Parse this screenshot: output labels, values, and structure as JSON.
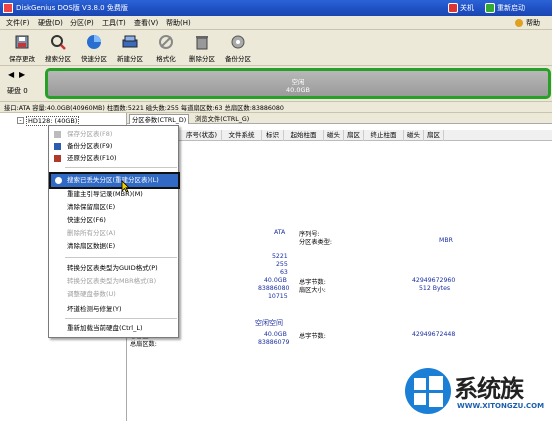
{
  "app": {
    "title": "DiskGenius DOS版 V3.8.0 免费版",
    "shutdown": "关机",
    "restart": "重新启动",
    "help": "帮助"
  },
  "menu": [
    "文件(F)",
    "硬盘(D)",
    "分区(P)",
    "工具(T)",
    "查看(V)",
    "帮助(H)"
  ],
  "toolbar": [
    {
      "label": "保存更改",
      "icon": "save-icon"
    },
    {
      "label": "搜索分区",
      "icon": "search-icon"
    },
    {
      "label": "快速分区",
      "icon": "quick-partition-icon"
    },
    {
      "label": "新建分区",
      "icon": "new-partition-icon"
    },
    {
      "label": "格式化",
      "icon": "format-icon"
    },
    {
      "label": "删除分区",
      "icon": "delete-icon"
    },
    {
      "label": "备份分区",
      "icon": "backup-icon"
    }
  ],
  "diskbar": {
    "disk_label": "硬盘 0",
    "region_line1": "空闲",
    "region_line2": "40.0GB"
  },
  "infobar": "接口:ATA  容量:40.0GB(40960MB)  柱面数:5221  磁头数:255  每道扇区数:63  总扇区数:83886080",
  "tree": {
    "node": "HD128: (40GB)"
  },
  "tabs": [
    "分区参数(CTRL_D)",
    "浏览文件(CTRL_G)"
  ],
  "columns": [
    "序号(状态)",
    "文件系统",
    "标识",
    "起始柱面",
    "磁头",
    "扇区",
    "终止柱面",
    "磁头",
    "扇区"
  ],
  "context_menu": [
    {
      "label": "保存分区表(F8)",
      "disabled": true,
      "icon": "save-icon"
    },
    {
      "label": "备份分区表(F9)",
      "disabled": false,
      "icon": "backup-table-icon"
    },
    {
      "label": "还原分区表(F10)",
      "disabled": false,
      "icon": "restore-table-icon"
    },
    {
      "label": "搜索已丢失分区(重建分区表)(L)",
      "disabled": false,
      "highlighted": true,
      "icon": "search-lost-icon"
    },
    {
      "label": "重建主引导记录(MBR)(M)",
      "disabled": false
    },
    {
      "label": "清除保留扇区(E)",
      "disabled": false
    },
    {
      "label": "快速分区(F6)",
      "disabled": false
    },
    {
      "label": "删除所有分区(A)",
      "disabled": true
    },
    {
      "label": "清除扇区数据(E)",
      "disabled": false
    },
    {
      "label": "转换分区表类型为GUID格式(P)",
      "disabled": false
    },
    {
      "label": "转换分区表类型为MBR格式(B)",
      "disabled": true
    },
    {
      "label": "调整硬盘参数(U)",
      "disabled": true
    },
    {
      "label": "坏道检测与修复(Y)",
      "disabled": false
    },
    {
      "label": "重新加载当前硬盘(Ctrl_L)",
      "disabled": false
    }
  ],
  "details": {
    "interface_value": "ATA",
    "serial_label": "序列号:",
    "pt_type_label": "分区表类型:",
    "pt_type_value": "MBR",
    "cylinders": "5221",
    "heads": "255",
    "sectors": "63",
    "capacity": "40.0GB",
    "total_bytes_label": "总字节数:",
    "total_bytes": "42949672960",
    "total_sectors": "83886080",
    "sector_size_label": "扇区大小:",
    "sector_size": "512 Bytes",
    "extra": "10715",
    "free_space": "空闲空间",
    "free_cap": "40.0GB",
    "free_total_bytes_label": "总字节数:",
    "free_total_bytes": "42949672448",
    "free_cap_label": "总容量:",
    "free_sectors_label": "总扇区数:",
    "free_sectors": "83886079"
  },
  "watermark": {
    "brand": "系统族",
    "url": "WWW.XITONGZU.COM"
  }
}
